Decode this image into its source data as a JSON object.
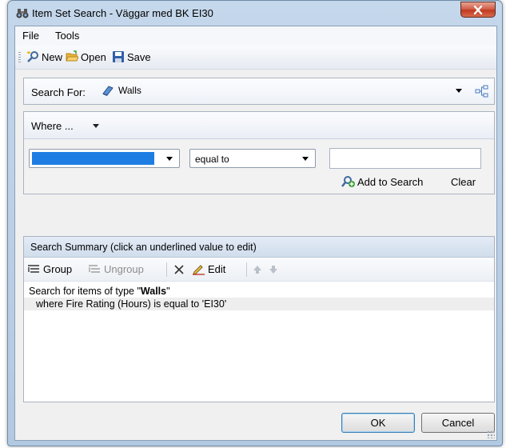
{
  "window": {
    "title": "Item Set Search - Väggar med BK EI30"
  },
  "menu": {
    "file": "File",
    "tools": "Tools"
  },
  "toolbar": {
    "new_label": "New",
    "open_label": "Open",
    "save_label": "Save"
  },
  "search_for": {
    "label": "Search For:",
    "value": "Walls"
  },
  "where": {
    "label": "Where ...",
    "condition_value": "equal to",
    "add_label": "Add to Search",
    "clear_label": "Clear"
  },
  "summary": {
    "title": "Search Summary (click an underlined value to edit)",
    "toolbar": {
      "group": "Group",
      "ungroup": "Ungroup",
      "edit": "Edit"
    },
    "line1_prefix": "Search for items of type \"",
    "line1_type": "Walls",
    "line1_suffix": "\"",
    "line2": "where Fire Rating (Hours) is equal to 'EI30'"
  },
  "buttons": {
    "ok": "OK",
    "cancel": "Cancel"
  },
  "colors": {
    "selection": "#1e7de3",
    "close": "#c1391f",
    "title_bar": "#c4d7eb"
  }
}
